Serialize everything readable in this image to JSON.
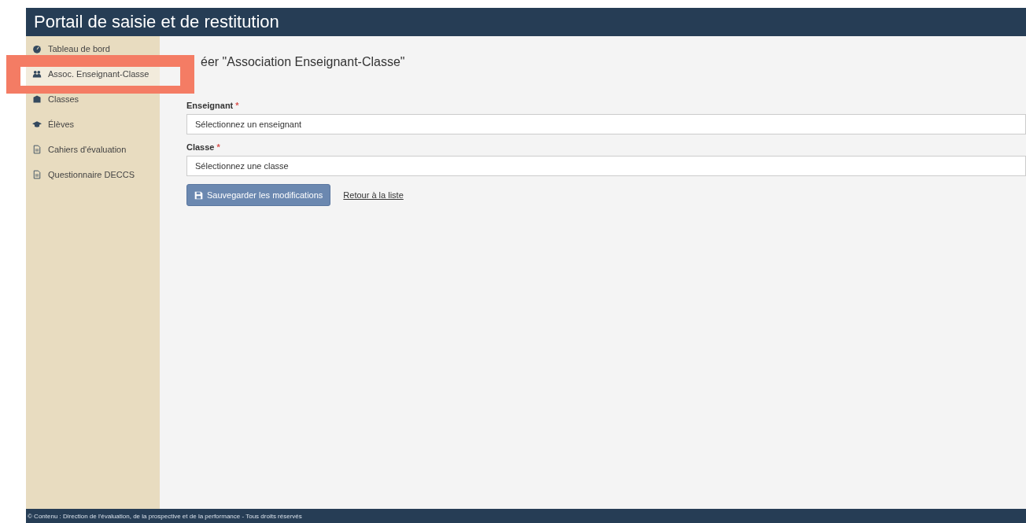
{
  "header": {
    "title": "Portail de saisie et de restitution"
  },
  "sidebar": {
    "items": [
      {
        "label": "Tableau de bord",
        "selected": false
      },
      {
        "label": "Assoc. Enseignant-Classe",
        "selected": true
      },
      {
        "label": "Classes",
        "selected": false
      },
      {
        "label": "Élèves",
        "selected": false
      },
      {
        "label": "Cahiers d'évaluation",
        "selected": false
      },
      {
        "label": "Questionnaire DECCS",
        "selected": false
      }
    ]
  },
  "page": {
    "title": "éer \"Association Enseignant-Classe\"",
    "fields": [
      {
        "label": "Enseignant",
        "required_mark": "*",
        "placeholder": "Sélectionnez un enseignant"
      },
      {
        "label": "Classe",
        "required_mark": "*",
        "placeholder": "Sélectionnez une classe"
      }
    ],
    "save_button": "Sauvegarder les modifications",
    "back_link": "Retour à la liste"
  },
  "footer": {
    "text": "© Contenu : Direction de l'évaluation, de la prospective et de la performance - Tous droits réservés"
  },
  "annotation": {
    "highlight": true
  }
}
